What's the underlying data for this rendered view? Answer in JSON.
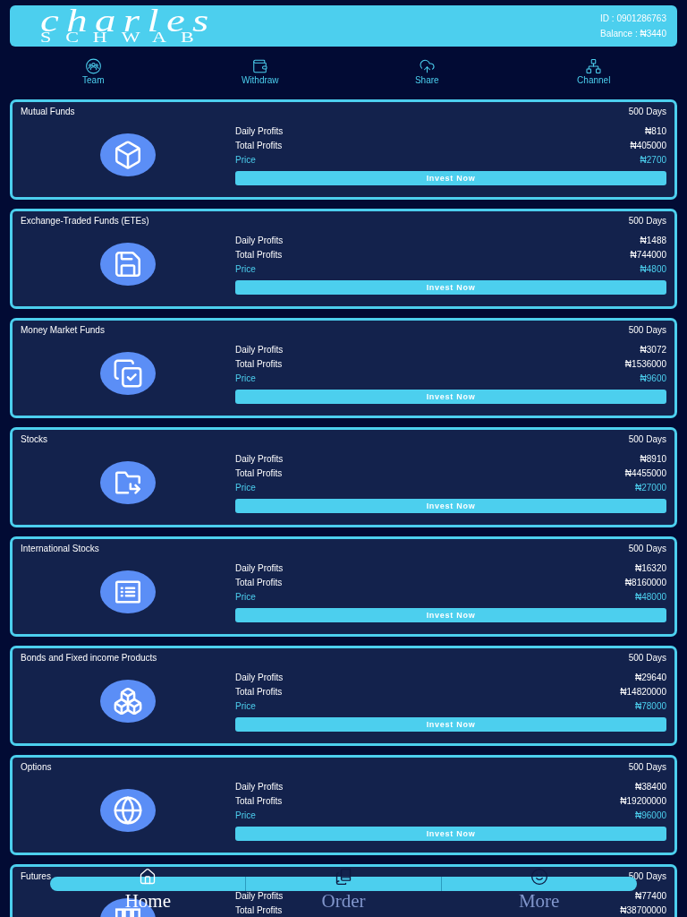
{
  "header": {
    "logo_top": "charles",
    "logo_bottom": "SCHWAB",
    "id": "ID : 0901286763",
    "balance": "Balance : ₦3440"
  },
  "nav": [
    "Team",
    "Withdraw",
    "Share",
    "Channel"
  ],
  "products": [
    {
      "title": "Mutual Funds",
      "duration": "500 Days",
      "rows": [
        {
          "kind": "profit",
          "label": "Daily Profits",
          "value": "₦810"
        },
        {
          "kind": "profit",
          "label": "Total Profits",
          "value": "₦405000"
        },
        {
          "kind": "price",
          "label": "Price",
          "value": "₦2700"
        }
      ],
      "button": "Invest Now"
    },
    {
      "title": "Exchange-Traded Funds (ETEs)",
      "duration": "500 Days",
      "rows": [
        {
          "kind": "profit",
          "label": "Daily Profits",
          "value": "₦1488"
        },
        {
          "kind": "profit",
          "label": "Total Profits",
          "value": "₦744000"
        },
        {
          "kind": "price",
          "label": "Price",
          "value": "₦4800"
        }
      ],
      "button": "Invest Now"
    },
    {
      "title": "Money Market Funds",
      "duration": "500 Days",
      "rows": [
        {
          "kind": "profit",
          "label": "Daily Profits",
          "value": "₦3072"
        },
        {
          "kind": "profit",
          "label": "Total Profits",
          "value": "₦1536000"
        },
        {
          "kind": "price",
          "label": "Price",
          "value": "₦9600"
        }
      ],
      "button": "Invest Now"
    },
    {
      "title": "Stocks",
      "duration": "500 Days",
      "rows": [
        {
          "kind": "profit",
          "label": "Daily Profits",
          "value": "₦8910"
        },
        {
          "kind": "profit",
          "label": "Total Profits",
          "value": "₦4455000"
        },
        {
          "kind": "price",
          "label": "Price",
          "value": "₦27000"
        }
      ],
      "button": "Invest Now"
    },
    {
      "title": "International Stocks",
      "duration": "500 Days",
      "rows": [
        {
          "kind": "profit",
          "label": "Daily Profits",
          "value": "₦16320"
        },
        {
          "kind": "profit",
          "label": "Total Profits",
          "value": "₦8160000"
        },
        {
          "kind": "price",
          "label": "Price",
          "value": "₦48000"
        }
      ],
      "button": "Invest Now"
    },
    {
      "title": "Bonds and Fixed income Products",
      "duration": "500 Days",
      "rows": [
        {
          "kind": "profit",
          "label": "Daily Profits",
          "value": "₦29640"
        },
        {
          "kind": "profit",
          "label": "Total Profits",
          "value": "₦14820000"
        },
        {
          "kind": "price",
          "label": "Price",
          "value": "₦78000"
        }
      ],
      "button": "Invest Now"
    },
    {
      "title": "Options",
      "duration": "500 Days",
      "rows": [
        {
          "kind": "profit",
          "label": "Daily Profits",
          "value": "₦38400"
        },
        {
          "kind": "profit",
          "label": "Total Profits",
          "value": "₦19200000"
        },
        {
          "kind": "price",
          "label": "Price",
          "value": "₦96000"
        }
      ],
      "button": "Invest Now"
    },
    {
      "title": "Futures",
      "duration": "500 Days",
      "rows": [
        {
          "kind": "profit",
          "label": "Daily Profits",
          "value": "₦77400"
        },
        {
          "kind": "profit",
          "label": "Total Profits",
          "value": "₦38700000"
        }
      ]
    }
  ],
  "bottom_nav": [
    {
      "label": "Home",
      "selected": true
    },
    {
      "label": "Order",
      "selected": false
    },
    {
      "label": "More",
      "selected": false
    }
  ]
}
